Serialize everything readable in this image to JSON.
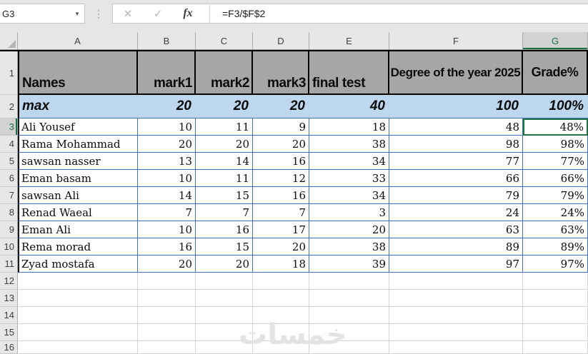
{
  "formula_bar": {
    "name_box_value": "G3",
    "dropdown_arrow": "▼",
    "cancel_label": "✕",
    "enter_label": "✓",
    "fx_label": "fx",
    "formula": "=F3/$F$2"
  },
  "sheet": {
    "column_headers": [
      "A",
      "B",
      "C",
      "D",
      "E",
      "F",
      "G"
    ],
    "selected": {
      "cell": "G3",
      "column": "G",
      "row": "3"
    },
    "header_row": {
      "num": "1",
      "cells": [
        "Names",
        "mark1",
        "mark2",
        "mark3",
        "final test",
        "Degree of the year 2025",
        "Grade%"
      ]
    },
    "max_row": {
      "num": "2",
      "cells": [
        "max",
        "20",
        "20",
        "20",
        "40",
        "100",
        "100%"
      ]
    },
    "data_rows": [
      {
        "num": "3",
        "cells": [
          "Ali Yousef",
          "10",
          "11",
          "9",
          "18",
          "48",
          "48%"
        ]
      },
      {
        "num": "4",
        "cells": [
          "Rama Mohammad",
          "20",
          "20",
          "20",
          "38",
          "98",
          "98%"
        ]
      },
      {
        "num": "5",
        "cells": [
          "sawsan nasser",
          "13",
          "14",
          "16",
          "34",
          "77",
          "77%"
        ]
      },
      {
        "num": "6",
        "cells": [
          "Eman basam",
          "10",
          "11",
          "12",
          "33",
          "66",
          "66%"
        ]
      },
      {
        "num": "7",
        "cells": [
          "sawsan Ali",
          "14",
          "15",
          "16",
          "34",
          "79",
          "79%"
        ]
      },
      {
        "num": "8",
        "cells": [
          "Renad Waeal",
          "7",
          "7",
          "7",
          "3",
          "24",
          "24%"
        ]
      },
      {
        "num": "9",
        "cells": [
          "Eman Ali",
          "10",
          "16",
          "17",
          "20",
          "63",
          "63%"
        ]
      },
      {
        "num": "10",
        "cells": [
          "Rema morad",
          "16",
          "15",
          "20",
          "38",
          "89",
          "89%"
        ]
      },
      {
        "num": "11",
        "cells": [
          "Zyad mostafa",
          "20",
          "20",
          "18",
          "39",
          "97",
          "97%"
        ]
      }
    ],
    "empty_row_numbers": [
      "12",
      "13",
      "14",
      "15",
      "16"
    ]
  },
  "watermark": "خمسات",
  "colors": {
    "header_fill": "#A6A6A6",
    "max_row_fill": "#BDD7EE",
    "table_border": "#4472C4",
    "selection_green": "#217346",
    "chrome_gray": "#E6E6E6"
  }
}
